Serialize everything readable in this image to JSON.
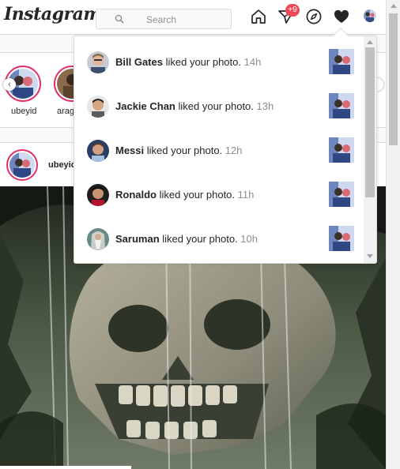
{
  "header": {
    "logo": "Instagram",
    "search_placeholder": "Search",
    "dm_badge": "+9",
    "icons": [
      "home-icon",
      "direct-message-icon",
      "explore-compass-icon",
      "heart-icon",
      "profile-avatar"
    ]
  },
  "stories": [
    {
      "name": "ubeyid"
    },
    {
      "name": "arag"
    }
  ],
  "post": {
    "username": "ubeyid"
  },
  "notifications": [
    {
      "user": "Bill Gates",
      "action": "liked your photo.",
      "time": "14h"
    },
    {
      "user": "Jackie Chan",
      "action": "liked your photo.",
      "time": "13h"
    },
    {
      "user": "Messi",
      "action": "liked your photo.",
      "time": "12h"
    },
    {
      "user": "Ronaldo",
      "action": "liked your photo.",
      "time": "11h"
    },
    {
      "user": "Saruman",
      "action": "liked your photo.",
      "time": "10h"
    }
  ],
  "colors": {
    "badge": "#ed4956",
    "story_ring": "#e1306c",
    "border": "#dbdbdb",
    "muted_text": "#8e8e8e"
  }
}
